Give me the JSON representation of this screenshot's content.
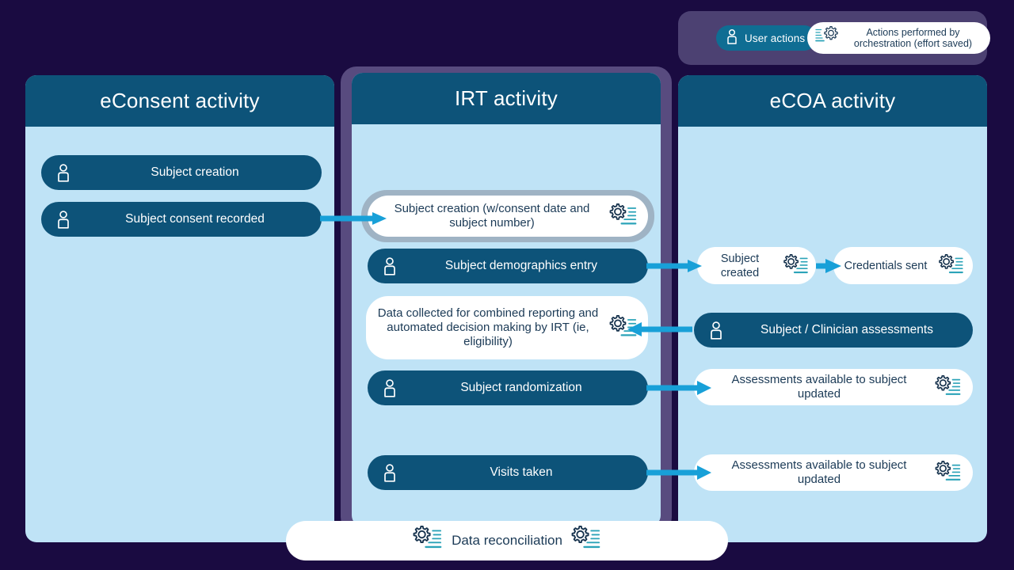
{
  "legend": {
    "user_actions_label": "User actions",
    "orchestration_label": "Actions performed by orchestration (effort saved)",
    "user_icon": "user-icon",
    "gear_icon": "gear-lines-icon",
    "container_color": "#4c4172",
    "user_pill_color": "#0f6d93"
  },
  "colors": {
    "background": "#1a0b41",
    "column_header": "#0d5379",
    "column_body": "#bfe3f6",
    "dark_pill": "#0d5379",
    "white_pill": "#ffffff",
    "arrow": "#18a0d8",
    "ring": "#9fb3c4",
    "irt_glow": "#584b7f",
    "text_dark": "#1b3a56",
    "gear_accent": "#2ba3b8"
  },
  "columns": [
    {
      "id": "econsent",
      "title": "eConsent activity",
      "items": [
        {
          "label": "Subject creation",
          "kind": "user",
          "icon": "user-icon"
        },
        {
          "label": "Subject consent recorded",
          "kind": "user",
          "icon": "user-icon"
        }
      ]
    },
    {
      "id": "irt",
      "title": "IRT activity",
      "items": [
        {
          "label": "Subject creation (w/consent date and subject number)",
          "kind": "orchestration",
          "icon": "gear-lines-icon",
          "highlighted": true
        },
        {
          "label": "Subject demographics entry",
          "kind": "user",
          "icon": "user-icon"
        },
        {
          "label": "Data collected for combined reporting and automated decision making by IRT (ie, eligibility)",
          "kind": "orchestration",
          "icon": "gear-lines-icon"
        },
        {
          "label": "Subject randomization",
          "kind": "user",
          "icon": "user-icon"
        },
        {
          "label": "Visits taken",
          "kind": "user",
          "icon": "user-icon"
        }
      ]
    },
    {
      "id": "ecoa",
      "title": "eCOA activity",
      "items": [
        {
          "label": "Subject created",
          "kind": "orchestration",
          "icon": "gear-lines-icon"
        },
        {
          "label": "Credentials sent",
          "kind": "orchestration",
          "icon": "gear-lines-icon"
        },
        {
          "label": "Subject  / Clinician assessments",
          "kind": "user",
          "icon": "user-icon"
        },
        {
          "label": "Assessments available to subject updated",
          "kind": "orchestration",
          "icon": "gear-lines-icon"
        },
        {
          "label": "Assessments available to subject updated",
          "kind": "orchestration",
          "icon": "gear-lines-icon"
        }
      ]
    }
  ],
  "bottom_bar": {
    "label": "Data reconciliation",
    "left_icon": "gear-lines-icon",
    "right_icon": "gear-lines-icon"
  },
  "arrows": [
    {
      "name": "econsent-to-irt-subject-creation",
      "direction": "right"
    },
    {
      "name": "irt-demographics-to-ecoa-subject-created",
      "direction": "right"
    },
    {
      "name": "ecoa-subject-created-to-credentials-sent",
      "direction": "right"
    },
    {
      "name": "ecoa-assessments-to-irt-data-collected",
      "direction": "left"
    },
    {
      "name": "irt-randomization-to-ecoa-assessments",
      "direction": "right"
    },
    {
      "name": "irt-visits-to-ecoa-assessments",
      "direction": "right"
    }
  ]
}
